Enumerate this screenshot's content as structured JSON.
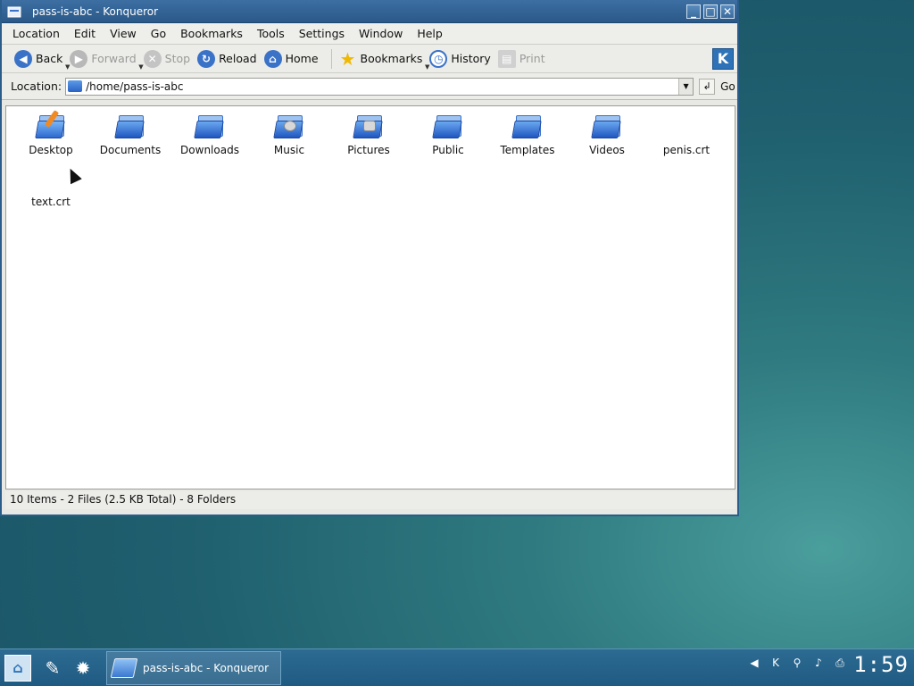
{
  "window": {
    "title": "pass-is-abc - Konqueror",
    "minimize": "_",
    "maximize": "□",
    "close": "✕"
  },
  "menu": [
    "Location",
    "Edit",
    "View",
    "Go",
    "Bookmarks",
    "Tools",
    "Settings",
    "Window",
    "Help"
  ],
  "toolbar": {
    "back": "Back",
    "forward": "Forward",
    "stop": "Stop",
    "reload": "Reload",
    "home": "Home",
    "bookmarks": "Bookmarks",
    "history": "History",
    "print": "Print"
  },
  "location": {
    "label": "Location:",
    "value": "/home/pass-is-abc",
    "go": "Go"
  },
  "files": [
    {
      "name": "Desktop",
      "icon": "desktop-folder-icon"
    },
    {
      "name": "Documents",
      "icon": "folder-icon"
    },
    {
      "name": "Downloads",
      "icon": "folder-icon"
    },
    {
      "name": "Music",
      "icon": "music-folder-icon"
    },
    {
      "name": "Pictures",
      "icon": "pictures-folder-icon"
    },
    {
      "name": "Public",
      "icon": "folder-icon"
    },
    {
      "name": "Templates",
      "icon": "folder-icon"
    },
    {
      "name": "Videos",
      "icon": "folder-icon"
    },
    {
      "name": "penis.crt",
      "icon": "file-icon"
    },
    {
      "name": "text.crt",
      "icon": "file-icon"
    }
  ],
  "status": "10 Items - 2 Files (2.5 KB Total) - 8 Folders",
  "taskbar": {
    "task_title": "pass-is-abc - Konqueror",
    "clock": "1:59"
  }
}
